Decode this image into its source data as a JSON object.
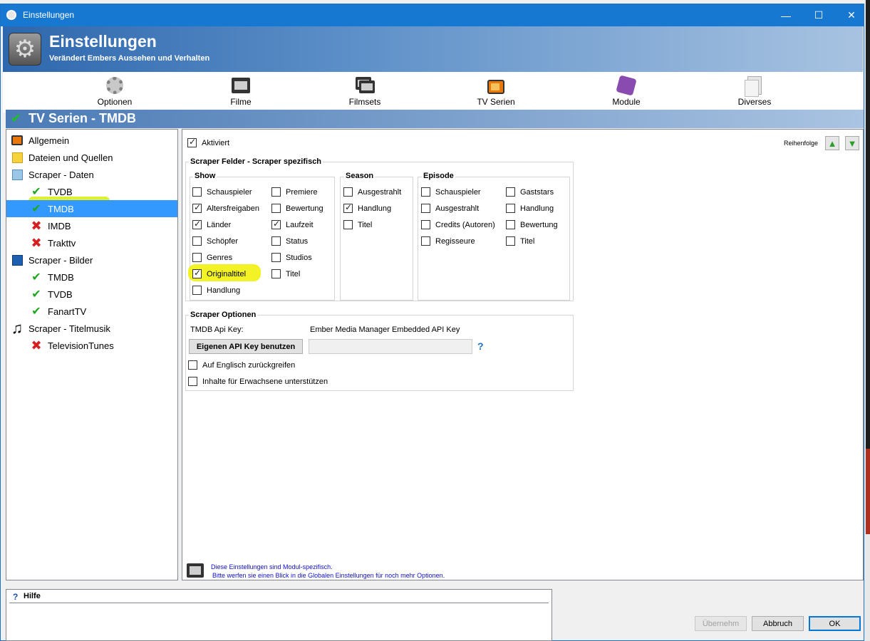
{
  "window": {
    "title": "Einstellungen",
    "minimize": "—",
    "maximize": "☐",
    "close": "✕"
  },
  "header": {
    "title": "Einstellungen",
    "subtitle": "Verändert Embers Aussehen und Verhalten"
  },
  "toolbar": [
    {
      "label": "Optionen",
      "icon": "gear-icon"
    },
    {
      "label": "Filme",
      "icon": "film-icon"
    },
    {
      "label": "Filmsets",
      "icon": "filmset-icon"
    },
    {
      "label": "TV Serien",
      "icon": "tv-icon"
    },
    {
      "label": "Module",
      "icon": "puzzle-icon"
    },
    {
      "label": "Diverses",
      "icon": "documents-icon"
    }
  ],
  "section": {
    "title": "TV Serien - TMDB"
  },
  "tree": [
    {
      "label": "Allgemein",
      "icon": "tv-icon",
      "level": 0
    },
    {
      "label": "Dateien und Quellen",
      "icon": "folder-icon",
      "level": 0
    },
    {
      "label": "Scraper - Daten",
      "icon": "scraper-icon",
      "level": 0
    },
    {
      "label": "TVDB",
      "icon": "check-icon",
      "level": 1
    },
    {
      "label": "TMDB",
      "icon": "check-icon",
      "level": 1,
      "selected": true
    },
    {
      "label": "IMDB",
      "icon": "cross-icon",
      "level": 1
    },
    {
      "label": "Trakttv",
      "icon": "cross-icon",
      "level": 1
    },
    {
      "label": "Scraper - Bilder",
      "icon": "image-icon",
      "level": 0
    },
    {
      "label": "TMDB",
      "icon": "check-icon",
      "level": 1
    },
    {
      "label": "TVDB",
      "icon": "check-icon",
      "level": 1
    },
    {
      "label": "FanartTV",
      "icon": "check-icon",
      "level": 1
    },
    {
      "label": "Scraper - Titelmusik",
      "icon": "music-icon",
      "level": 0
    },
    {
      "label": "TelevisionTunes",
      "icon": "cross-icon",
      "level": 1
    }
  ],
  "content": {
    "activated": {
      "label": "Aktiviert",
      "checked": true
    },
    "order_label": "Reihenfolge",
    "fields_group": "Scraper Felder - Scraper spezifisch",
    "show": {
      "label": "Show",
      "col1": [
        {
          "label": "Schauspieler",
          "checked": false
        },
        {
          "label": "Altersfreigaben",
          "checked": true
        },
        {
          "label": "Länder",
          "checked": true
        },
        {
          "label": "Schöpfer",
          "checked": false
        },
        {
          "label": "Genres",
          "checked": false
        },
        {
          "label": "Originaltitel",
          "checked": true
        },
        {
          "label": "Handlung",
          "checked": false
        }
      ],
      "col2": [
        {
          "label": "Premiere",
          "checked": false
        },
        {
          "label": "Bewertung",
          "checked": false
        },
        {
          "label": "Laufzeit",
          "checked": true
        },
        {
          "label": "Status",
          "checked": false
        },
        {
          "label": "Studios",
          "checked": false
        },
        {
          "label": "Titel",
          "checked": false
        }
      ]
    },
    "season": {
      "label": "Season",
      "items": [
        {
          "label": "Ausgestrahlt",
          "checked": false
        },
        {
          "label": "Handlung",
          "checked": true
        },
        {
          "label": "Titel",
          "checked": false
        }
      ]
    },
    "episode": {
      "label": "Episode",
      "col1": [
        {
          "label": "Schauspieler",
          "checked": false
        },
        {
          "label": "Ausgestrahlt",
          "checked": false
        },
        {
          "label": "Credits (Autoren)",
          "checked": false
        },
        {
          "label": "Regisseure",
          "checked": false
        }
      ],
      "col2": [
        {
          "label": "Gaststars",
          "checked": false
        },
        {
          "label": "Handlung",
          "checked": false
        },
        {
          "label": "Bewertung",
          "checked": false
        },
        {
          "label": "Titel",
          "checked": false
        }
      ]
    },
    "options": {
      "label": "Scraper Optionen",
      "api_key_label": "TMDB Api Key:",
      "api_key_value": "Ember Media Manager Embedded API Key",
      "own_key_button": "Eigenen API Key benutzen",
      "help_mark": "?",
      "fallback_english": {
        "label": "Auf Englisch zurückgreifen",
        "checked": false
      },
      "adult": {
        "label": "Inhalte für Erwachsene unterstützen",
        "checked": false
      }
    },
    "note_line1": "Diese Einstellungen sind Modul-spezifisch.",
    "note_line2": "Bitte werfen sie einen Blick in die Globalen Einstellungen für noch mehr Optionen."
  },
  "help": {
    "icon": "?",
    "title": "Hilfe"
  },
  "buttons": {
    "apply": "Übernehm",
    "cancel": "Abbruch",
    "ok": "OK"
  },
  "colors": {
    "titlebar": "#1778d2",
    "selection": "#3399ff",
    "highlight": "#f2f20a",
    "check_green": "#1fa81f",
    "cross_red": "#d42020"
  }
}
